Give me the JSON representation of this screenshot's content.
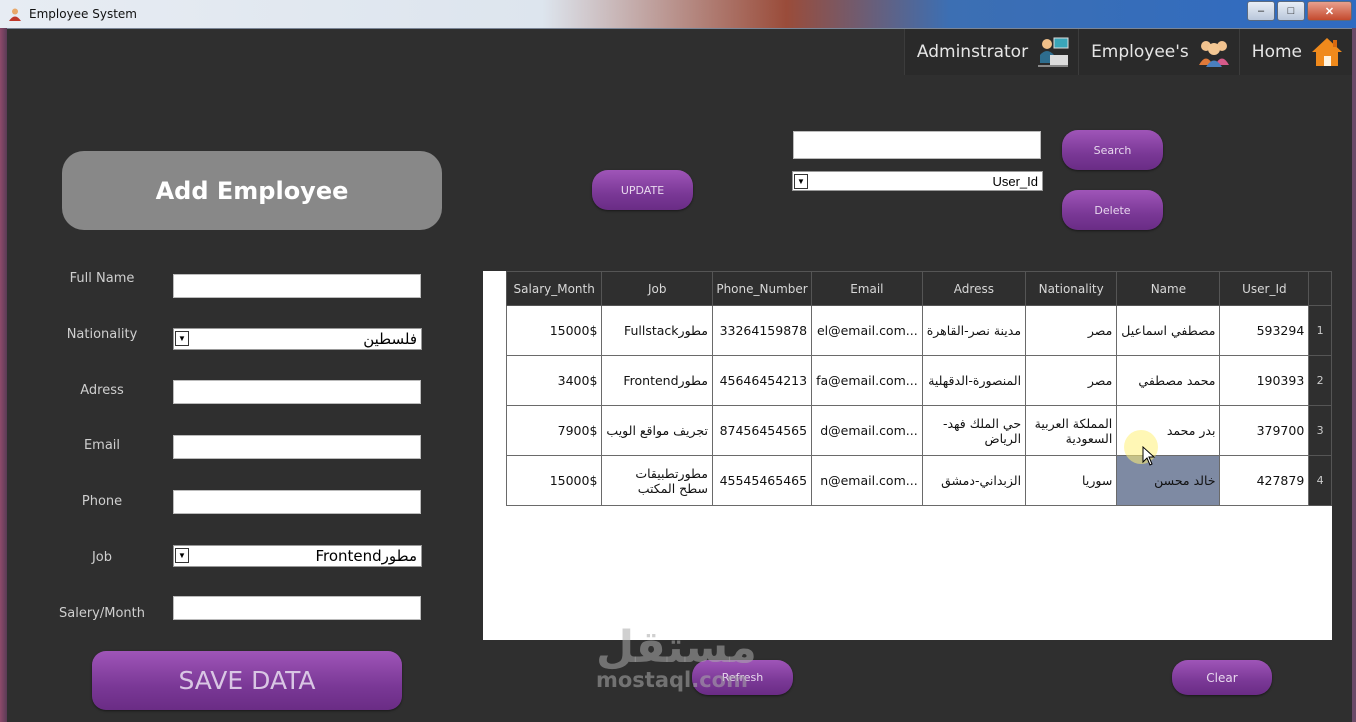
{
  "window": {
    "title": "Employee System"
  },
  "nav": [
    {
      "label": "Adminstrator",
      "icon": "admin-computer-icon"
    },
    {
      "label": "Employee's",
      "icon": "employees-group-icon"
    },
    {
      "label": "Home",
      "icon": "home-icon"
    }
  ],
  "form": {
    "heading": "Add Employee",
    "full_name": {
      "label": "Full Name",
      "value": ""
    },
    "nationality": {
      "label": "Nationality",
      "value": "فلسطين"
    },
    "adress": {
      "label": "Adress",
      "value": ""
    },
    "email": {
      "label": "Email",
      "value": ""
    },
    "phone": {
      "label": "Phone",
      "value": ""
    },
    "job": {
      "label": "Job",
      "value": "Frontendمطور"
    },
    "salary": {
      "label": "Salery/Month",
      "value": ""
    },
    "save_label": "SAVE DATA"
  },
  "actions": {
    "update_label": "UPDATE",
    "search_label": "Search",
    "delete_label": "Delete",
    "refresh_label": "Refresh",
    "clear_label": "Clear",
    "search_value": "",
    "search_field": "User_Id"
  },
  "table": {
    "columns": [
      "Salary_Month",
      "Job",
      "Phone_Number",
      "Email",
      "Adress",
      "Nationality",
      "Name",
      "User_Id"
    ],
    "rows": [
      {
        "num": "1",
        "salary": "15000$",
        "job": "Fullstackمطور",
        "phone": "33264159878",
        "email": "el@email.com...",
        "adress": "مدينة نصر-القاهرة",
        "nationality": "مصر",
        "name": "مصطفي اسماعيل",
        "user_id": "593294"
      },
      {
        "num": "2",
        "salary": "3400$",
        "job": "Frontendمطور",
        "phone": "45646454213",
        "email": "fa@email.com...",
        "adress": "المنصورة-الدقهلية",
        "nationality": "مصر",
        "name": "محمد مصطفي",
        "user_id": "190393"
      },
      {
        "num": "3",
        "salary": "7900$",
        "job": "تجريف مواقع الويب",
        "phone": "87456454565",
        "email": "d@email.com...",
        "adress": "حي الملك فهد-الرياض",
        "nationality": "المملكة العربية السعودية",
        "name": "بدر محمد",
        "user_id": "379700"
      },
      {
        "num": "4",
        "salary": "15000$",
        "job": "مطورتطبيقات سطح المكتب",
        "phone": "45545465465",
        "email": "n@email.com...",
        "adress": "الزبداني-دمشق",
        "nationality": "سوريا",
        "name": "خالد محسن",
        "user_id": "427879"
      }
    ]
  },
  "watermark": {
    "arabic": "مستقل",
    "latin": "mostaql.com"
  }
}
